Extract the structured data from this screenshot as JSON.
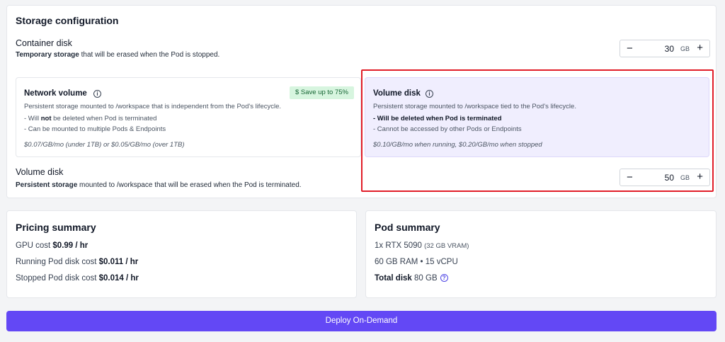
{
  "storage": {
    "title": "Storage configuration",
    "container": {
      "title": "Container disk",
      "desc_bold": "Temporary storage",
      "desc_rest": " that will be erased when the Pod is stopped.",
      "value": "30",
      "unit": "GB"
    },
    "network_card": {
      "title": "Network volume",
      "badge": "$  Save up to 75%",
      "desc": "Persistent storage mounted to /workspace that is independent from the Pod's lifecycle.",
      "b1_pre": "- Will ",
      "b1_bold": "not",
      "b1_post": " be deleted when Pod is terminated",
      "b2": "- Can be mounted to multiple Pods & Endpoints",
      "price": "$0.07/GB/mo (under 1TB) or $0.05/GB/mo (over 1TB)"
    },
    "volume_card": {
      "title": "Volume disk",
      "desc": "Persistent storage mounted to /workspace tied to the Pod's lifecycle.",
      "b1": "- Will be deleted when Pod is terminated",
      "b2": "- Cannot be accessed by other Pods or Endpoints",
      "price": "$0.10/GB/mo when running, $0.20/GB/mo when stopped"
    },
    "volume": {
      "title": "Volume disk",
      "desc_bold": "Persistent storage",
      "desc_rest": " mounted to /workspace that will be erased when the Pod is terminated.",
      "value": "50",
      "unit": "GB"
    },
    "minus_glyph": "−",
    "plus_glyph": "+"
  },
  "pricing": {
    "title": "Pricing summary",
    "gpu_label": "GPU cost ",
    "gpu_value": "$0.99 / hr",
    "running_label": "Running Pod disk cost ",
    "running_value": "$0.011 / hr",
    "stopped_label": "Stopped Pod disk cost ",
    "stopped_value": "$0.014 / hr"
  },
  "pod": {
    "title": "Pod summary",
    "gpu_line": "1x RTX 5090 ",
    "gpu_vram": "(32 GB VRAM)",
    "ram_line": "60 GB RAM • 15 vCPU",
    "disk_label": "Total disk",
    "disk_value": " 80 GB"
  },
  "deploy": {
    "label": "Deploy On-Demand"
  },
  "colors": {
    "accent": "#6348f5",
    "highlight": "#e11d28",
    "badge_bg": "#d7f5df",
    "selected_bg": "#f0eefe"
  },
  "icons": {
    "info": "i",
    "help": "?"
  }
}
